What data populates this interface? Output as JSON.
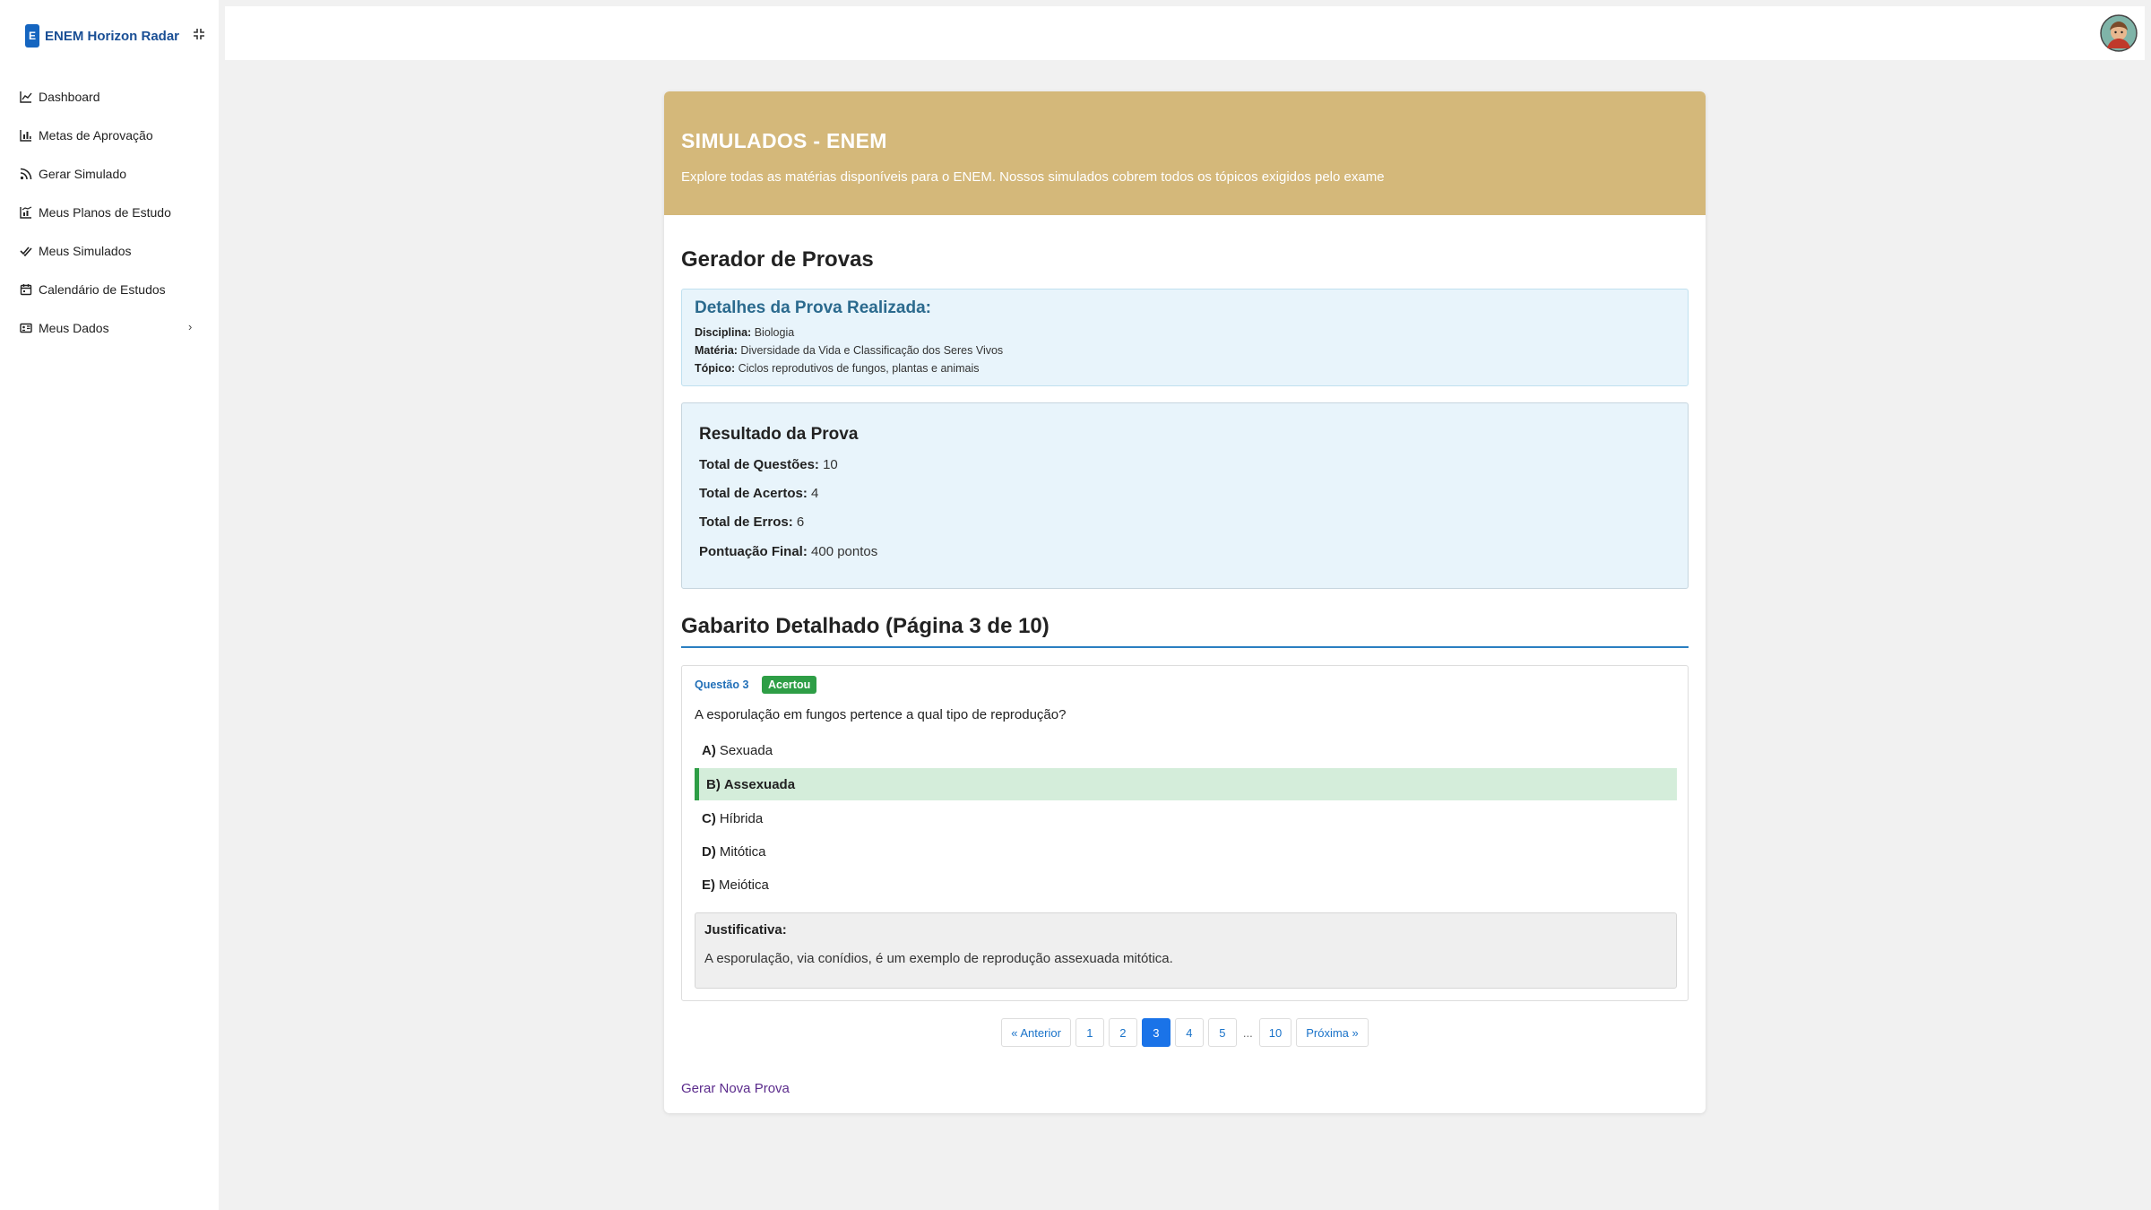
{
  "brand": {
    "logo_letter": "E",
    "name": "ENEM Horizon Radar"
  },
  "sidebar": {
    "items": [
      {
        "label": "Dashboard",
        "icon": "chart-line-icon"
      },
      {
        "label": "Metas de Aprovação",
        "icon": "bar-chart-icon"
      },
      {
        "label": "Gerar Simulado",
        "icon": "rss-icon"
      },
      {
        "label": "Meus Planos de Estudo",
        "icon": "chart-plan-icon"
      },
      {
        "label": "Meus Simulados",
        "icon": "double-check-icon"
      },
      {
        "label": "Calendário de Estudos",
        "icon": "calendar-icon"
      },
      {
        "label": "Meus Dados",
        "icon": "id-card-icon",
        "has_submenu": true
      }
    ]
  },
  "hero": {
    "title": "SIMULADOS - ENEM",
    "subtitle": "Explore todas as matérias disponíveis para o ENEM. Nossos simulados cobrem todos os tópicos exigidos pelo exame"
  },
  "main": {
    "title": "Gerador de Provas",
    "details": {
      "title": "Detalhes da Prova Realizada:",
      "disciplina_label": "Disciplina:",
      "disciplina": "Biologia",
      "materia_label": "Matéria:",
      "materia": "Diversidade da Vida e Classificação dos Seres Vivos",
      "topico_label": "Tópico:",
      "topico": "Ciclos reprodutivos de fungos, plantas e animais"
    },
    "result": {
      "title": "Resultado da Prova",
      "total_label": "Total de Questões:",
      "total": "10",
      "acertos_label": "Total de Acertos:",
      "acertos": "4",
      "erros_label": "Total de Erros:",
      "erros": "6",
      "pontuacao_label": "Pontuação Final:",
      "pontuacao": "400 pontos"
    },
    "gabarito_title": "Gabarito Detalhado (Página 3 de 10)",
    "question": {
      "number": "Questão 3",
      "status": "Acertou",
      "text": "A esporulação em fungos pertence a qual tipo de reprodução?",
      "options": [
        {
          "letter": "A)",
          "text": "Sexuada",
          "correct": false
        },
        {
          "letter": "B)",
          "text": "Assexuada",
          "correct": true
        },
        {
          "letter": "C)",
          "text": "Híbrida",
          "correct": false
        },
        {
          "letter": "D)",
          "text": "Mitótica",
          "correct": false
        },
        {
          "letter": "E)",
          "text": "Meiótica",
          "correct": false
        }
      ],
      "justification_title": "Justificativa:",
      "justification": "A esporulação, via conídios, é um exemplo de reprodução assexuada mitótica."
    },
    "pagination": {
      "prev": "« Anterior",
      "pages": [
        "1",
        "2",
        "3",
        "4",
        "5"
      ],
      "active": "3",
      "ellipsis": "...",
      "last": "10",
      "next": "Próxima »"
    },
    "new_exam_link": "Gerar Nova Prova"
  },
  "colors": {
    "hero_bg": "#d4b87a",
    "primary": "#1a73e8",
    "success": "#2e9e46",
    "correct_bg": "#d4edda",
    "info_bg": "#e8f4fb"
  }
}
